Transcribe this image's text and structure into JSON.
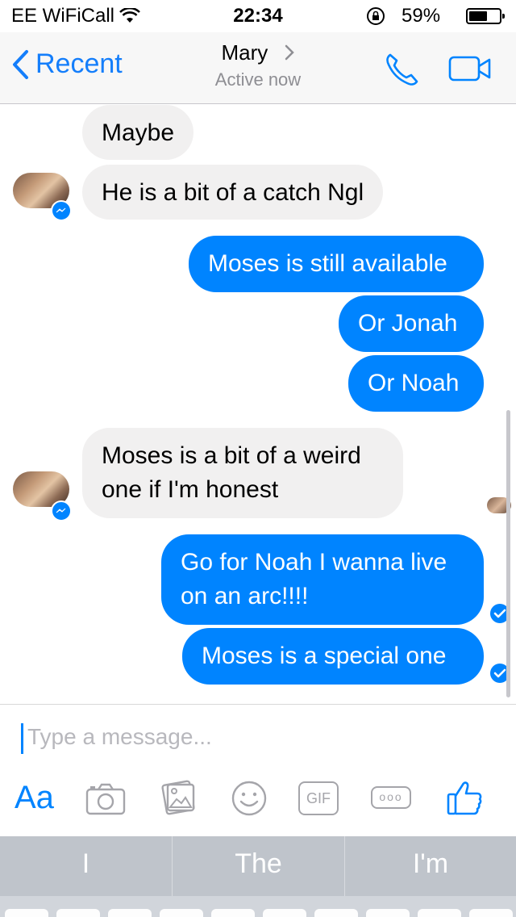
{
  "status_bar": {
    "carrier": "EE WiFiCall",
    "time": "22:34",
    "battery": "59%"
  },
  "nav": {
    "back_label": "Recent",
    "title": "Mary",
    "subtitle": "Active now"
  },
  "messages": [
    {
      "from": "Mary",
      "text": "Maybe"
    },
    {
      "from": "Mary",
      "text": "He is a bit of a catch Ngl"
    },
    {
      "from": "me",
      "text": "Moses is still available"
    },
    {
      "from": "me",
      "text": "Or Jonah"
    },
    {
      "from": "me",
      "text": "Or Noah"
    },
    {
      "from": "Mary",
      "text_lines": [
        "Moses is a bit of a weird",
        "one if I'm honest"
      ]
    },
    {
      "from": "me",
      "text_lines": [
        "Go for Noah I wanna live",
        "on an arc!!!!"
      ]
    },
    {
      "from": "me",
      "text": "Moses is a special one"
    }
  ],
  "composer": {
    "placeholder": "Type a message...",
    "aa_label": "Aa",
    "gif_label": "GIF",
    "more_label": "ooo"
  },
  "keyboard": {
    "suggestions": [
      "I",
      "The",
      "I'm"
    ]
  },
  "colors": {
    "accent": "#0084ff",
    "ios_blue": "#147efb",
    "incoming_bubble": "#f1f0f0"
  },
  "icons": [
    "back-chevron-icon",
    "phone-icon",
    "video-icon",
    "messenger-badge-icon",
    "read-check-icon",
    "camera-icon",
    "photo-icon",
    "emoji-icon",
    "like-icon",
    "wifi-icon",
    "lock-rotation-icon",
    "battery-icon"
  ]
}
